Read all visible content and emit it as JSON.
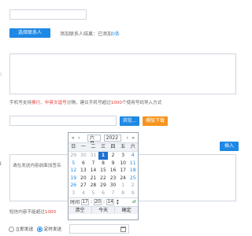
{
  "top_input": {
    "value": ""
  },
  "contacts": {
    "choose_button": "选择联系人",
    "added_prefix": "添加联系人结果：已添加",
    "added_count": "0条"
  },
  "side_label_1": ":",
  "side_label_2": "i",
  "phone_hint": {
    "prefix": "手机号支持",
    "sep1": "换行",
    "mid1": "、",
    "sep2": "中英文逗号",
    "mid2": "分隔，建议手机号超过",
    "limit": "1000",
    "suffix": "个使用号码导入方式"
  },
  "import": {
    "browse_button": "浏览...",
    "template_button": "模版下载",
    "right_button": "插入"
  },
  "content": {
    "placeholder": "请在发送内容前面加签名"
  },
  "sms_hint": {
    "prefix": "短信内容不能超过",
    "limit": "1000"
  },
  "send": {
    "now_label": "立即发送",
    "timed_label": "定时发送",
    "selected": "timed"
  },
  "calendar": {
    "month": "六月",
    "year": "2022",
    "weekdays": [
      "日",
      "一",
      "二",
      "三",
      "四",
      "五",
      "六"
    ],
    "days": [
      [
        "29",
        "30",
        "31",
        "1",
        "2",
        "3",
        "4"
      ],
      [
        "5",
        "6",
        "7",
        "8",
        "9",
        "10",
        "11"
      ],
      [
        "12",
        "13",
        "14",
        "15",
        "16",
        "17",
        "18"
      ],
      [
        "19",
        "20",
        "21",
        "22",
        "23",
        "24",
        "25"
      ],
      [
        "26",
        "27",
        "28",
        "29",
        "30",
        "1",
        "2"
      ],
      [
        "3",
        "4",
        "5",
        "6",
        "7",
        "8",
        "9"
      ]
    ],
    "selected_day": "1",
    "time_label": "时间",
    "hour": "17",
    "minute": "20",
    "second": "14",
    "clear_label": "清空",
    "today_label": "今天",
    "ok_label": "确定"
  },
  "colors": {
    "accent": "#1e88e5",
    "warning": "#f7941d",
    "highlight": "#e53935"
  }
}
